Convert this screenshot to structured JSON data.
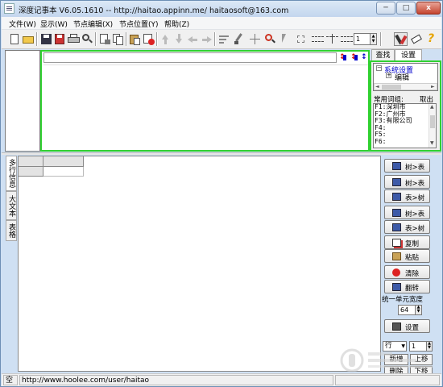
{
  "window": {
    "title": "深度记事本 V6.05.1610 -- http://haitao.appinn.me/  haitaosoft@163.com",
    "min_label": "─",
    "max_label": "□",
    "close_label": "x"
  },
  "menu": {
    "items": [
      "文件(W)",
      "显示(W)",
      "节点编辑(X)",
      "节点位置(Y)",
      "帮助(Z)"
    ]
  },
  "toolbar": {
    "spin_value": "1"
  },
  "right_panel": {
    "tabs": [
      "查找",
      "设置"
    ],
    "tree": {
      "root_label": "系统设置",
      "child_label": "编辑"
    },
    "common_words": {
      "label": "常用词组:",
      "fetch_label": "取出",
      "entries": [
        "F1:深圳市",
        "F2:广州市",
        "F3:有限公司",
        "F4:",
        "F5:",
        "F6:"
      ]
    }
  },
  "vertical_tabs": [
    "多行信息",
    "大文本",
    "表格"
  ],
  "side_buttons": [
    {
      "label": "树>表",
      "icon": "table-icon"
    },
    {
      "label": "树>表",
      "icon": "table-icon"
    },
    {
      "label": "表>树",
      "icon": "table-icon"
    },
    {
      "label": "树>表",
      "icon": "table-icon"
    },
    {
      "label": "表>树",
      "icon": "table-icon"
    },
    {
      "label": "复制",
      "icon": "copy-icon"
    },
    {
      "label": "粘贴",
      "icon": "paste-icon"
    },
    {
      "label": "清除",
      "icon": "clear-icon"
    },
    {
      "label": "翻转",
      "icon": "flip-icon"
    }
  ],
  "column_width": {
    "label": "统一单元宽度",
    "value": "64",
    "set_label": "设置"
  },
  "bottom_controls": {
    "row_select": "行",
    "row_number": "1",
    "add_label": "新增",
    "up_label": "上移",
    "delete_label": "删除",
    "down_label": "下移"
  },
  "status": {
    "left": "空",
    "url": "http://www.hoolee.com/user/haitao"
  },
  "colors": {
    "accent_green": "#31d131",
    "tree_link": "#0000cc"
  }
}
